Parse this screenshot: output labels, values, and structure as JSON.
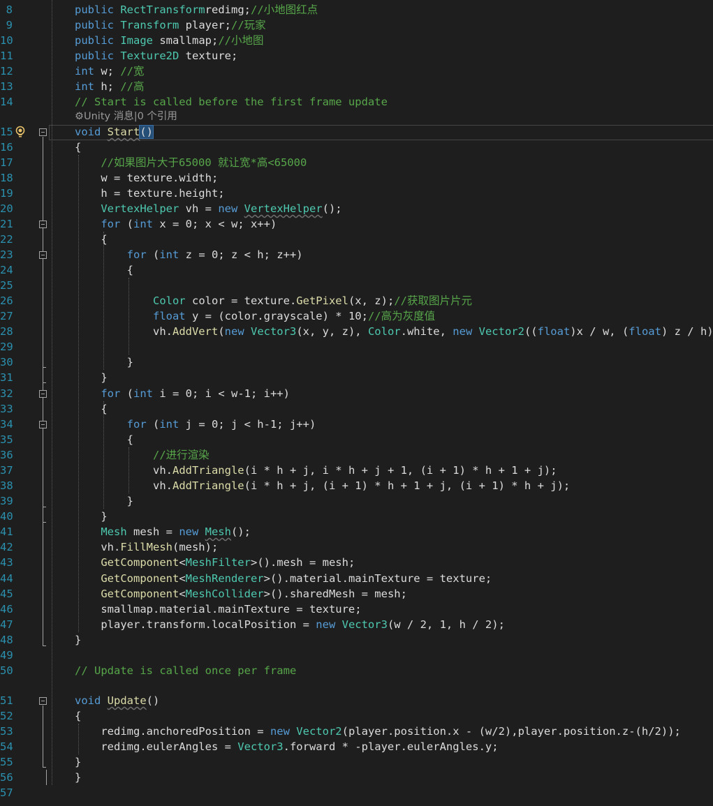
{
  "editor": {
    "codelens": "⚙Unity 消息|0 个引用",
    "lines": [
      {
        "n": "8",
        "parts": [
          [
            "kw",
            "public "
          ],
          [
            "ty",
            "RectTransform"
          ],
          [
            "",
            "redimg;"
          ],
          [
            "cm",
            "//小地图红点"
          ]
        ]
      },
      {
        "n": "9",
        "parts": [
          [
            "kw",
            "public "
          ],
          [
            "ty",
            "Transform"
          ],
          [
            "",
            " player;"
          ],
          [
            "cm",
            "//玩家"
          ]
        ]
      },
      {
        "n": "10",
        "parts": [
          [
            "kw",
            "public "
          ],
          [
            "ty",
            "Image"
          ],
          [
            "",
            " smallmap;"
          ],
          [
            "cm",
            "//小地图"
          ]
        ]
      },
      {
        "n": "11",
        "parts": [
          [
            "kw",
            "public "
          ],
          [
            "ty",
            "Texture2D"
          ],
          [
            "",
            " texture;"
          ]
        ]
      },
      {
        "n": "12",
        "parts": [
          [
            "kw",
            "int"
          ],
          [
            "",
            " w; "
          ],
          [
            "cm",
            "//宽"
          ]
        ]
      },
      {
        "n": "13",
        "parts": [
          [
            "kw",
            "int"
          ],
          [
            "",
            " h; "
          ],
          [
            "cm",
            "//高"
          ]
        ]
      },
      {
        "n": "14",
        "parts": [
          [
            "cm",
            "// Start is called before the first frame update"
          ]
        ]
      },
      {
        "n": "15",
        "parts": [
          [
            "kw",
            "void "
          ],
          [
            "fn squig",
            "Start"
          ],
          [
            "sel",
            "()"
          ]
        ]
      },
      {
        "n": "16",
        "parts": [
          [
            "",
            "{"
          ]
        ]
      },
      {
        "n": "17",
        "parts": [
          [
            "",
            "    "
          ],
          [
            "cm",
            "//如果图片大于65000 就让宽*高<65000"
          ]
        ]
      },
      {
        "n": "18",
        "parts": [
          [
            "",
            "    w = texture.width;"
          ]
        ]
      },
      {
        "n": "19",
        "parts": [
          [
            "",
            "    h = texture.height;"
          ]
        ]
      },
      {
        "n": "20",
        "parts": [
          [
            "",
            "    "
          ],
          [
            "ty",
            "VertexHelper"
          ],
          [
            "",
            " vh = "
          ],
          [
            "kw",
            "new "
          ],
          [
            "ty squig",
            "VertexHelper"
          ],
          [
            "",
            "();"
          ]
        ]
      },
      {
        "n": "21",
        "parts": [
          [
            "",
            "    "
          ],
          [
            "kw",
            "for"
          ],
          [
            "",
            " ("
          ],
          [
            "kw",
            "int"
          ],
          [
            "",
            " x = 0; x < w; x++)"
          ]
        ]
      },
      {
        "n": "22",
        "parts": [
          [
            "",
            "    {"
          ]
        ]
      },
      {
        "n": "23",
        "parts": [
          [
            "",
            "        "
          ],
          [
            "kw",
            "for"
          ],
          [
            "",
            " ("
          ],
          [
            "kw",
            "int"
          ],
          [
            "",
            " z = 0; z < h; z++)"
          ]
        ]
      },
      {
        "n": "24",
        "parts": [
          [
            "",
            "        {"
          ]
        ]
      },
      {
        "n": "25",
        "parts": [
          [
            "",
            ""
          ]
        ]
      },
      {
        "n": "26",
        "parts": [
          [
            "",
            "            "
          ],
          [
            "ty",
            "Color"
          ],
          [
            "",
            " color = texture."
          ],
          [
            "fn",
            "GetPixel"
          ],
          [
            "",
            "(x, z);"
          ],
          [
            "cm",
            "//获取图片片元"
          ]
        ]
      },
      {
        "n": "27",
        "parts": [
          [
            "",
            "            "
          ],
          [
            "kw",
            "float"
          ],
          [
            "",
            " y = (color.grayscale) * 10;"
          ],
          [
            "cm",
            "//高为灰度值"
          ]
        ]
      },
      {
        "n": "28",
        "parts": [
          [
            "",
            "            vh."
          ],
          [
            "fn",
            "AddVert"
          ],
          [
            "",
            "("
          ],
          [
            "kw",
            "new "
          ],
          [
            "ty",
            "Vector3"
          ],
          [
            "",
            "(x, y, z), "
          ],
          [
            "ty",
            "Color"
          ],
          [
            "",
            ".white, "
          ],
          [
            "kw",
            "new "
          ],
          [
            "ty",
            "Vector2"
          ],
          [
            "",
            "(("
          ],
          [
            "kw",
            "float"
          ],
          [
            "",
            ")x / w, ("
          ],
          [
            "kw",
            "float"
          ],
          [
            "",
            ") z / h));"
          ]
        ]
      },
      {
        "n": "29",
        "parts": [
          [
            "",
            ""
          ]
        ]
      },
      {
        "n": "30",
        "parts": [
          [
            "",
            "        }"
          ]
        ]
      },
      {
        "n": "31",
        "parts": [
          [
            "",
            "    }"
          ]
        ]
      },
      {
        "n": "32",
        "parts": [
          [
            "",
            "    "
          ],
          [
            "kw",
            "for"
          ],
          [
            "",
            " ("
          ],
          [
            "kw",
            "int"
          ],
          [
            "",
            " i = 0; i < w-1; i++)"
          ]
        ]
      },
      {
        "n": "33",
        "parts": [
          [
            "",
            "    {"
          ]
        ]
      },
      {
        "n": "34",
        "parts": [
          [
            "",
            "        "
          ],
          [
            "kw",
            "for"
          ],
          [
            "",
            " ("
          ],
          [
            "kw",
            "int"
          ],
          [
            "",
            " j = 0; j < h-1; j++)"
          ]
        ]
      },
      {
        "n": "35",
        "parts": [
          [
            "",
            "        {"
          ]
        ]
      },
      {
        "n": "36",
        "parts": [
          [
            "",
            "            "
          ],
          [
            "cm",
            "//进行渲染"
          ]
        ]
      },
      {
        "n": "37",
        "parts": [
          [
            "",
            "            vh."
          ],
          [
            "fn",
            "AddTriangle"
          ],
          [
            "",
            "(i * h + j, i * h + j + 1, (i + 1) * h + 1 + j);"
          ]
        ]
      },
      {
        "n": "38",
        "parts": [
          [
            "",
            "            vh."
          ],
          [
            "fn",
            "AddTriangle"
          ],
          [
            "",
            "(i * h + j, (i + 1) * h + 1 + j, (i + 1) * h + j);"
          ]
        ]
      },
      {
        "n": "39",
        "parts": [
          [
            "",
            "        }"
          ]
        ]
      },
      {
        "n": "40",
        "parts": [
          [
            "",
            "    }"
          ]
        ]
      },
      {
        "n": "41",
        "parts": [
          [
            "",
            "    "
          ],
          [
            "ty",
            "Mesh"
          ],
          [
            "",
            " mesh = "
          ],
          [
            "kw",
            "new "
          ],
          [
            "ty squig",
            "Mesh"
          ],
          [
            "",
            "();"
          ]
        ]
      },
      {
        "n": "42",
        "parts": [
          [
            "",
            "    vh."
          ],
          [
            "fn",
            "FillMesh"
          ],
          [
            "",
            "(mesh);"
          ]
        ]
      },
      {
        "n": "43",
        "parts": [
          [
            "",
            "    "
          ],
          [
            "fn",
            "GetComponent"
          ],
          [
            "",
            "<"
          ],
          [
            "ty",
            "MeshFilter"
          ],
          [
            "",
            ">().mesh = mesh;"
          ]
        ]
      },
      {
        "n": "44",
        "parts": [
          [
            "",
            "    "
          ],
          [
            "fn",
            "GetComponent"
          ],
          [
            "",
            "<"
          ],
          [
            "ty",
            "MeshRenderer"
          ],
          [
            "",
            ">().material.mainTexture = texture;"
          ]
        ]
      },
      {
        "n": "45",
        "parts": [
          [
            "",
            "    "
          ],
          [
            "fn",
            "GetComponent"
          ],
          [
            "",
            "<"
          ],
          [
            "ty",
            "MeshCollider"
          ],
          [
            "",
            ">().sharedMesh = mesh;"
          ]
        ]
      },
      {
        "n": "46",
        "parts": [
          [
            "",
            "    smallmap.material.mainTexture = texture;"
          ]
        ]
      },
      {
        "n": "47",
        "parts": [
          [
            "",
            "    player.transform.localPosition = "
          ],
          [
            "kw",
            "new "
          ],
          [
            "ty",
            "Vector3"
          ],
          [
            "",
            "(w / 2, 1, h / 2);"
          ]
        ]
      },
      {
        "n": "48",
        "parts": [
          [
            "",
            "}"
          ]
        ]
      },
      {
        "n": "49",
        "parts": [
          [
            "",
            ""
          ]
        ]
      },
      {
        "n": "50",
        "parts": [
          [
            "cm",
            "// Update is called once per frame"
          ]
        ]
      },
      {
        "n": "51",
        "parts": [
          [
            "kw",
            "void "
          ],
          [
            "fn squig",
            "Update"
          ],
          [
            "",
            "()"
          ]
        ]
      },
      {
        "n": "52",
        "parts": [
          [
            "",
            "{"
          ]
        ]
      },
      {
        "n": "53",
        "parts": [
          [
            "",
            "    redimg.anchoredPosition = "
          ],
          [
            "kw",
            "new "
          ],
          [
            "ty",
            "Vector2"
          ],
          [
            "",
            "(player.position.x - (w/2),player.position.z-(h/2));"
          ]
        ]
      },
      {
        "n": "54",
        "parts": [
          [
            "",
            "    redimg.eulerAngles = "
          ],
          [
            "ty",
            "Vector3"
          ],
          [
            "",
            ".forward * -player.eulerAngles.y;"
          ]
        ]
      },
      {
        "n": "55",
        "parts": [
          [
            "",
            "}"
          ]
        ]
      },
      {
        "n": "56",
        "parts": [
          [
            "",
            "}"
          ]
        ]
      },
      {
        "n": "57",
        "parts": [
          [
            "",
            ""
          ]
        ]
      }
    ],
    "colors": {
      "background": "#1e1e1e",
      "keyword": "#569cd6",
      "type": "#4ec9b0",
      "comment": "#57a64a",
      "method": "#dcdcaa",
      "line_number": "#2b91af"
    },
    "icons": {
      "lightbulb": "lightbulb-icon",
      "fold": "collapse-icon",
      "codelens": "unity-icon"
    }
  }
}
